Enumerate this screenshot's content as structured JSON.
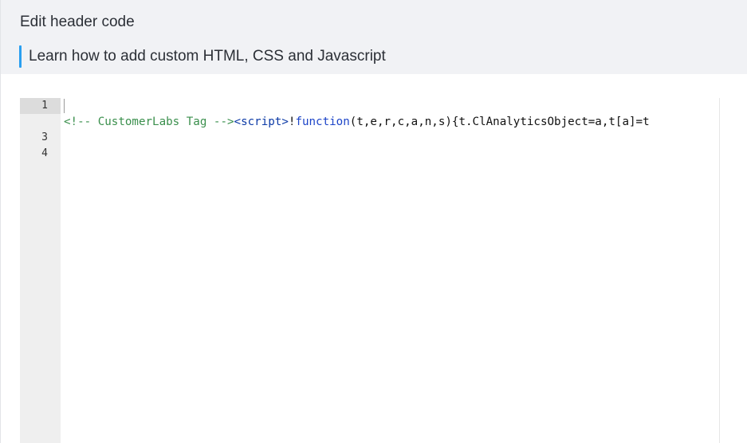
{
  "dialog": {
    "title": "Edit header code",
    "help_link": "Learn how to add custom HTML, CSS and Javascript"
  },
  "editor": {
    "line_numbers": [
      "1",
      "",
      "3",
      "4"
    ],
    "active_line": 1,
    "code_line_2": {
      "comment": "<!-- CustomerLabs Tag -->",
      "tag": "<script>",
      "bang": "!",
      "keyword": "function",
      "rest": "(t,e,r,c,a,n,s){t.ClAnalyticsObject=a,t[a]=t"
    }
  },
  "colors": {
    "accent": "#2a9ff0",
    "comment": "#3a8f4c",
    "tag": "#0c3aa6",
    "keyword": "#1c44c8",
    "header_bg": "#f1f2f5",
    "gutter_bg": "#efefef"
  }
}
